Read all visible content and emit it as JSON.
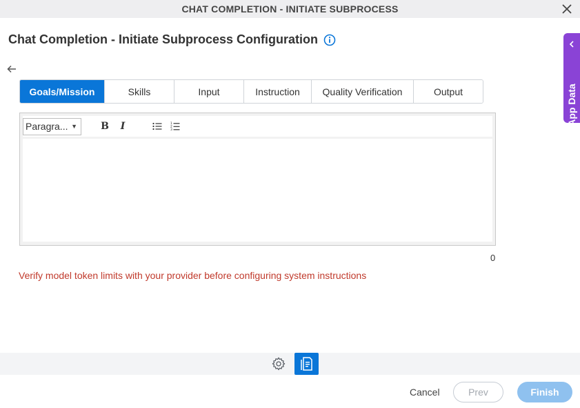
{
  "window": {
    "title": "CHAT COMPLETION - INITIATE SUBPROCESS"
  },
  "page": {
    "title": "Chat Completion - Initiate Subprocess Configuration"
  },
  "tabs": [
    {
      "label": "Goals/Mission",
      "active": true
    },
    {
      "label": "Skills",
      "active": false
    },
    {
      "label": "Input",
      "active": false
    },
    {
      "label": "Instruction",
      "active": false
    },
    {
      "label": "Quality Verification",
      "active": false
    },
    {
      "label": "Output",
      "active": false
    }
  ],
  "editor": {
    "format_value": "Paragra...",
    "bold_label": "B",
    "italic_label": "I",
    "content": "",
    "char_count": "0"
  },
  "warning": "Verify model token limits with your provider before configuring system instructions",
  "side_panel": {
    "label": "App Data"
  },
  "footer": {
    "cancel_label": "Cancel",
    "prev_label": "Prev",
    "finish_label": "Finish"
  },
  "icons": {
    "close": "close-icon",
    "info": "info-icon",
    "back": "arrow-left-icon",
    "bullet_list": "bulleted-list-icon",
    "numbered_list": "numbered-list-icon",
    "settings": "gear-icon",
    "document": "document-icon",
    "collapse": "chevron-left-icon"
  },
  "colors": {
    "accent": "#0a76d8",
    "side_panel": "#8a43d6",
    "warning": "#c0392b",
    "finish_disabled": "#8fc1ef"
  }
}
